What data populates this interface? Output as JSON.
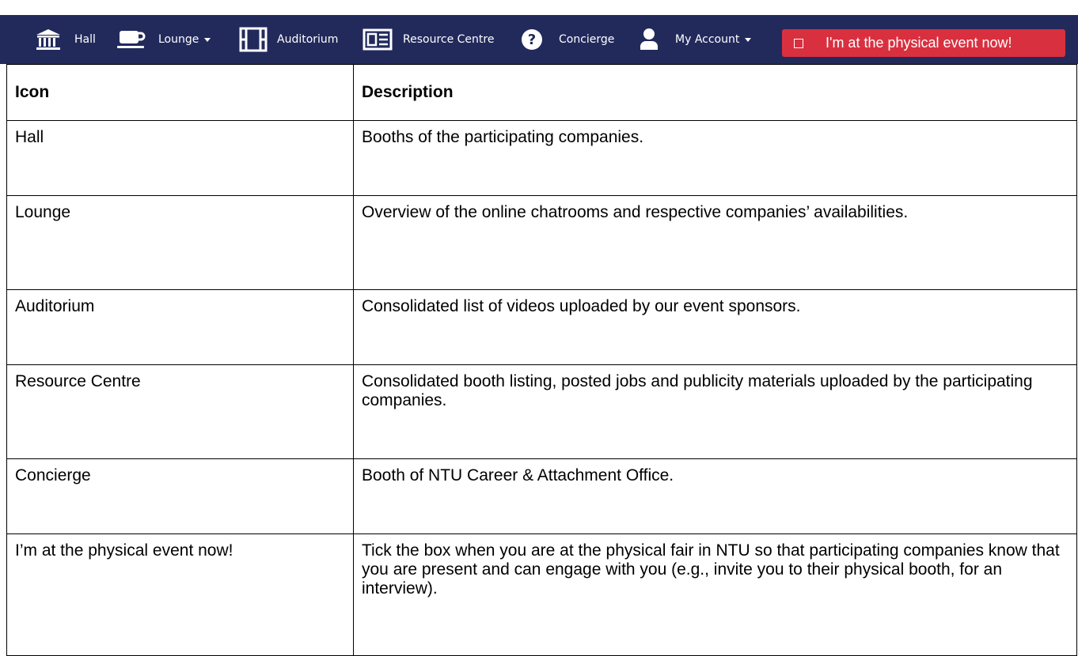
{
  "nav": {
    "items": [
      {
        "label": "Hall",
        "icon": "museum-icon"
      },
      {
        "label": "Lounge",
        "icon": "coffee-cup-icon",
        "dropdown": true
      },
      {
        "label": "Auditorium",
        "icon": "film-icon"
      },
      {
        "label": "Resource Centre",
        "icon": "newspaper-icon"
      },
      {
        "label": "Concierge",
        "icon": "question-circle-icon"
      },
      {
        "label": "My Account",
        "icon": "user-icon",
        "dropdown": true
      }
    ],
    "physical_button": {
      "label": "I'm at the physical event now!",
      "checked": false
    },
    "colors": {
      "background": "#222a5c",
      "button": "#d9303f"
    }
  },
  "table": {
    "headers": [
      "Icon",
      "Description"
    ],
    "rows": [
      {
        "icon": "Hall",
        "description": "Booths of the participating companies."
      },
      {
        "icon": "Lounge",
        "description": "Overview of the online chatrooms and respective companies’ availabilities."
      },
      {
        "icon": "Auditorium",
        "description": "Consolidated list of videos uploaded by our event sponsors."
      },
      {
        "icon": "Resource Centre",
        "description": "Consolidated booth listing, posted jobs and publicity materials uploaded by the participating companies."
      },
      {
        "icon": "Concierge",
        "description": "Booth of NTU Career & Attachment Office."
      },
      {
        "icon": "I’m at the physical event now!",
        "description": "Tick the box when you are at the physical fair in NTU so that participating companies know that you are present and can engage with you (e.g., invite you to their physical booth, for an interview)."
      }
    ]
  }
}
